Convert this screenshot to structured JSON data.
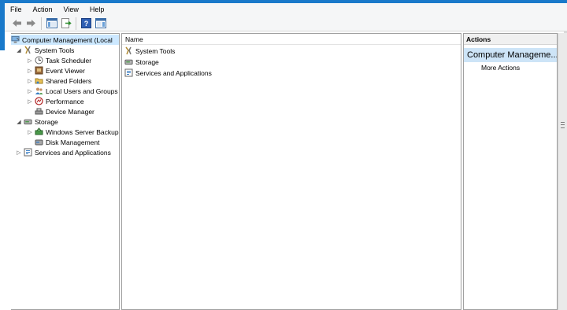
{
  "menu": [
    "File",
    "Action",
    "View",
    "Help"
  ],
  "toolbar": {
    "buttons": [
      {
        "name": "back-arrow-icon"
      },
      {
        "name": "forward-arrow-icon"
      },
      {
        "name": "show-hide-console-tree-icon"
      },
      {
        "name": "export-list-icon"
      },
      {
        "name": "help-icon"
      },
      {
        "name": "show-hide-action-pane-icon"
      }
    ]
  },
  "tree": {
    "root": "Computer Management (Local",
    "system_tools": "System Tools",
    "task_scheduler": "Task Scheduler",
    "event_viewer": "Event Viewer",
    "shared_folders": "Shared Folders",
    "local_users": "Local Users and Groups",
    "performance": "Performance",
    "device_manager": "Device Manager",
    "storage": "Storage",
    "windows_server_backup": "Windows Server Backup",
    "disk_management": "Disk Management",
    "services_apps": "Services and Applications"
  },
  "center": {
    "column_header": "Name",
    "items": [
      "System Tools",
      "Storage",
      "Services and Applications"
    ]
  },
  "actions": {
    "header": "Actions",
    "section": "Computer Manageme...",
    "more": "More Actions"
  },
  "colors": {
    "accent": "#1979ca",
    "selection": "#cce8ff",
    "actions_section": "#cde4f7"
  }
}
